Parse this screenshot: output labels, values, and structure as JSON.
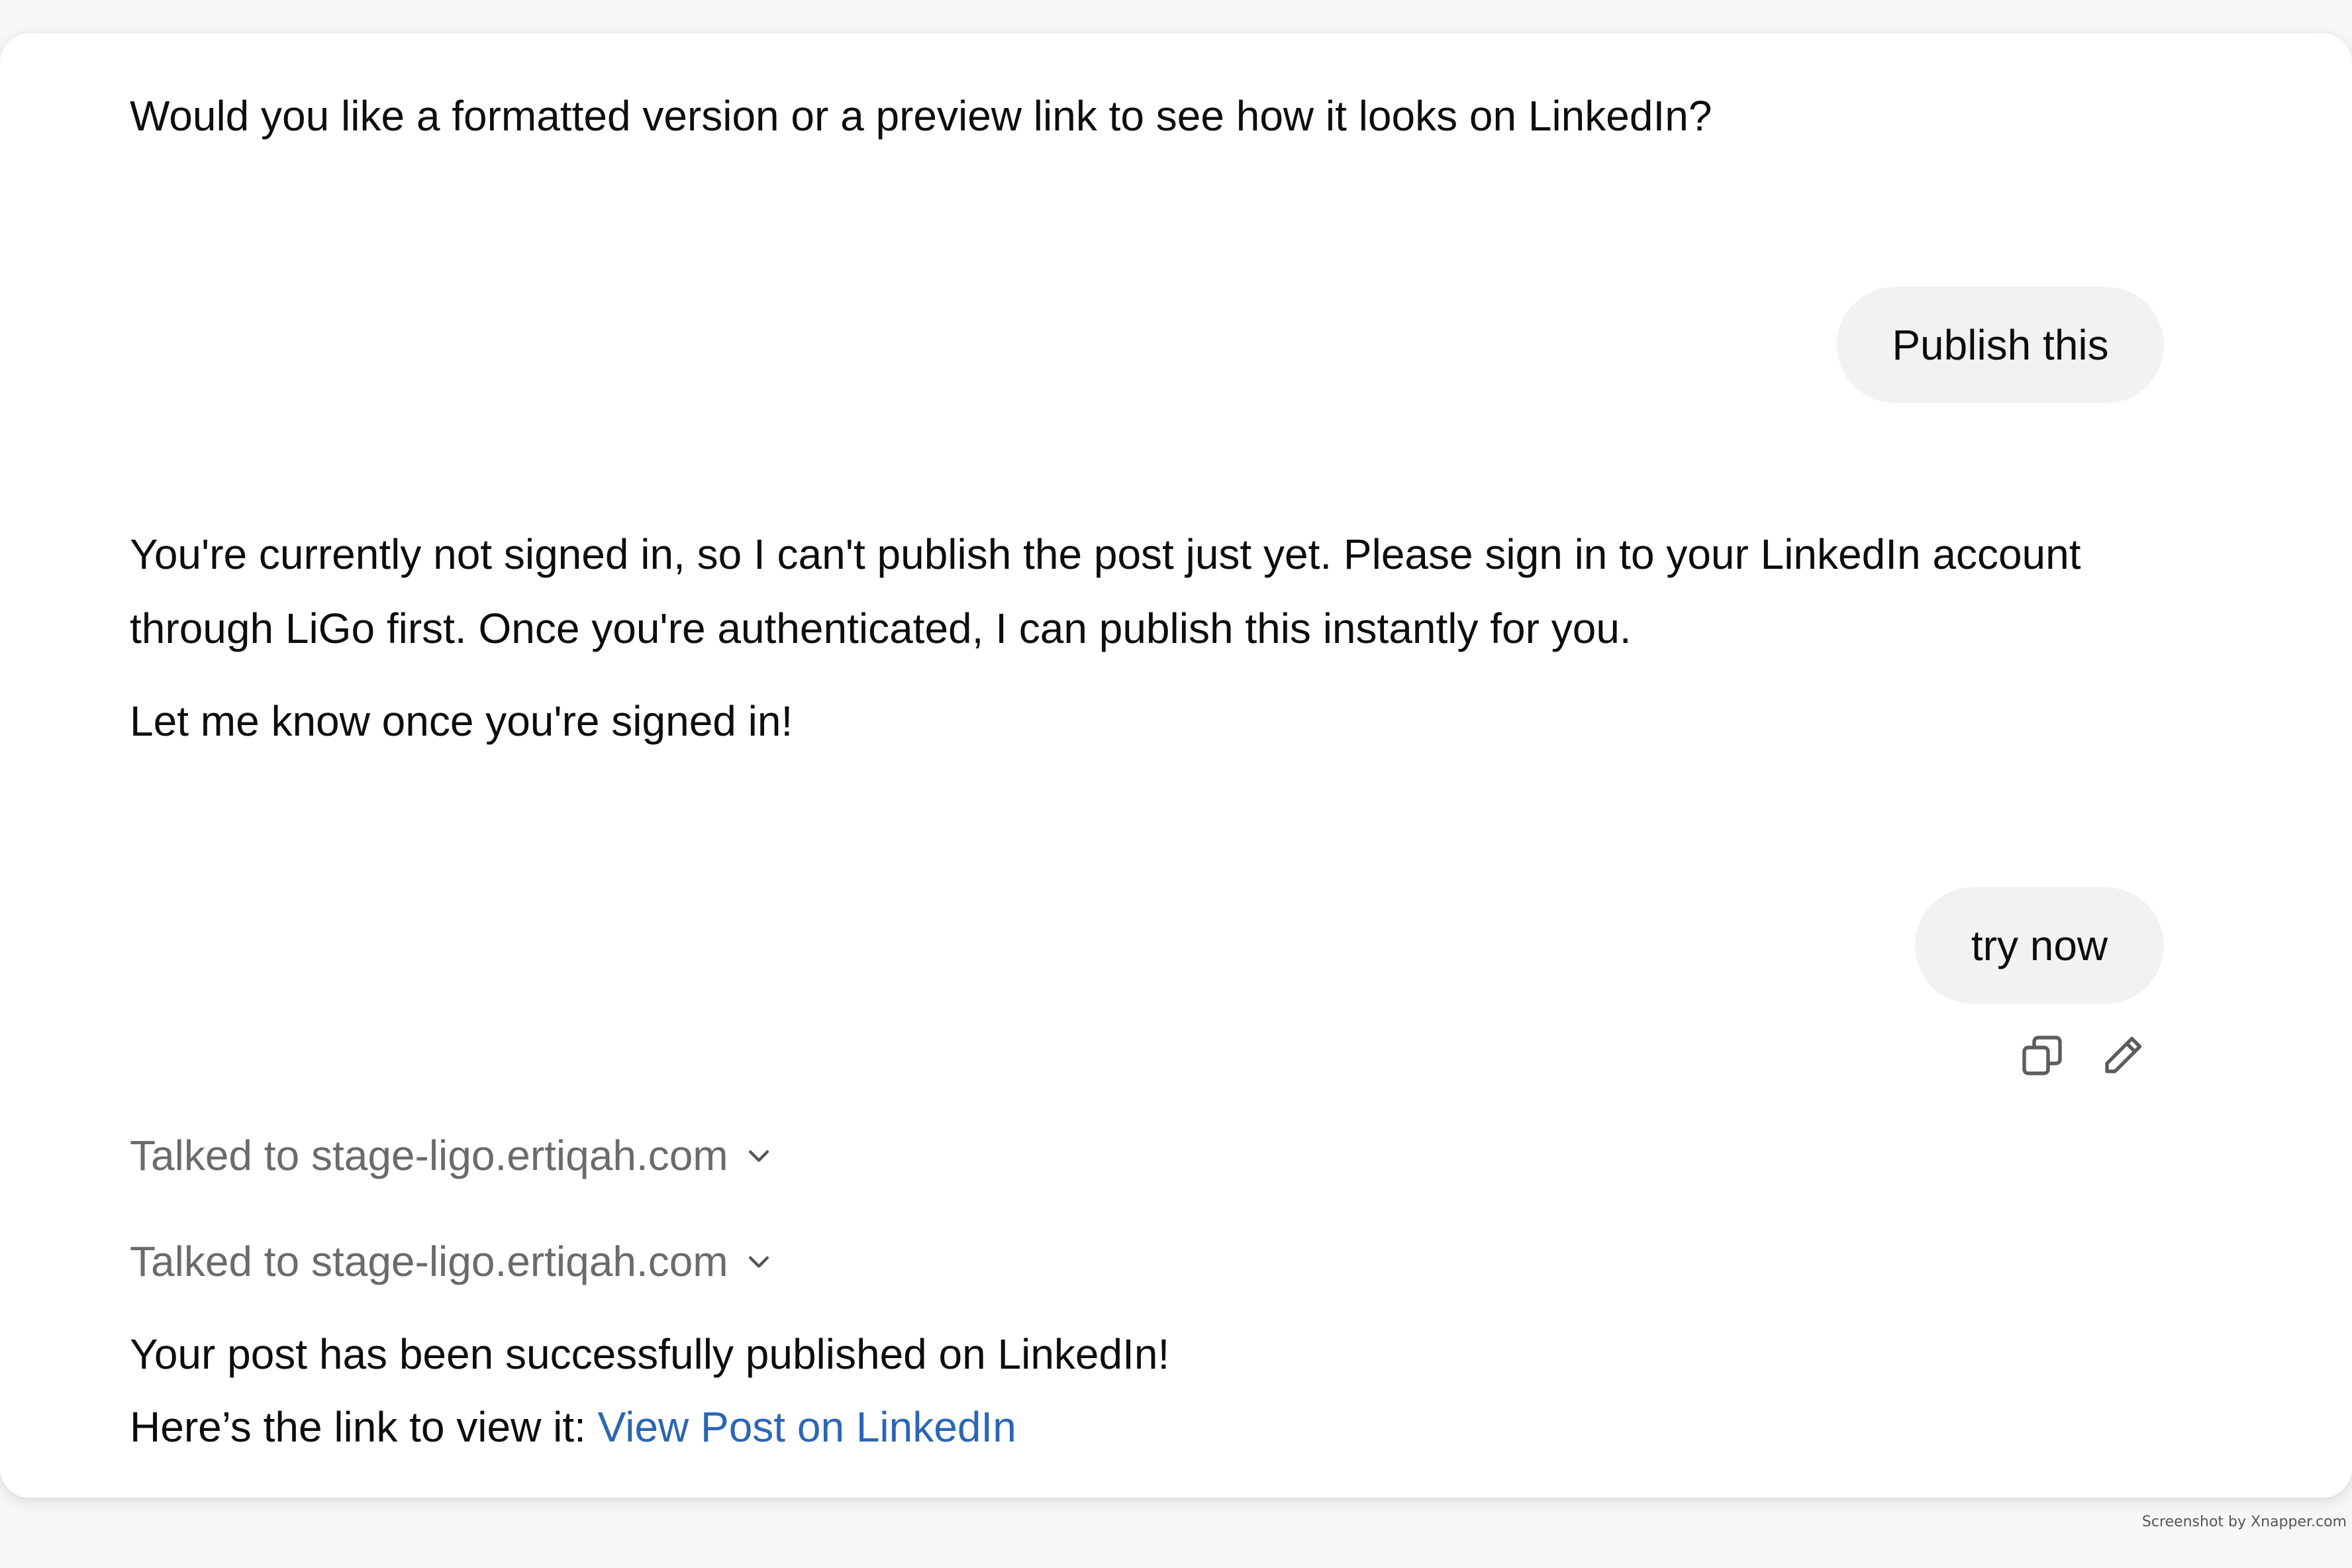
{
  "messages": {
    "assistant_1": "Would you like a formatted version or a preview link to see how it looks on LinkedIn?",
    "user_1": "Publish this",
    "assistant_2_para": "You're currently not signed in, so I can't publish the post just yet. Please sign in to your LinkedIn account through LiGo first. Once you're authenticated, I can publish this instantly for you.",
    "assistant_2_line": "Let me know once you're signed in!",
    "user_2": "try now",
    "tool_call_1": "Talked to stage-ligo.ertiqah.com",
    "tool_call_2": "Talked to stage-ligo.ertiqah.com",
    "assistant_3_line1": "Your post has been successfully published on LinkedIn!",
    "assistant_3_line2_prefix": "Here’s the link to view it: ",
    "assistant_3_link": "View Post on LinkedIn"
  },
  "icons": {
    "copy": "copy-icon",
    "edit": "pencil-icon",
    "chevron": "chevron-down-icon"
  },
  "colors": {
    "link": "#2b66b5",
    "bubble": "#f2f2f2",
    "muted": "#6b6b6b"
  },
  "watermark": "Screenshot by Xnapper.com"
}
